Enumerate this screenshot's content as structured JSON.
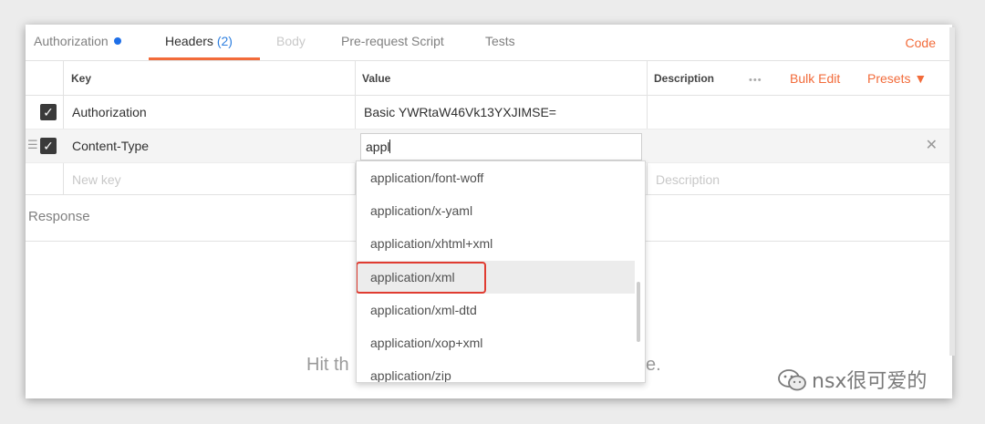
{
  "tabs": [
    {
      "label": "Authorization"
    },
    {
      "label": "Headers",
      "count": "(2)"
    },
    {
      "label": "Body"
    },
    {
      "label": "Pre-request Script"
    },
    {
      "label": "Tests"
    }
  ],
  "code_link": "Code",
  "table": {
    "headers": {
      "key": "Key",
      "value": "Value",
      "description": "Description"
    },
    "bulk_edit": "Bulk Edit",
    "presets": "Presets ▼",
    "more": "•••",
    "rows": [
      {
        "checked": true,
        "key": "Authorization",
        "value": "Basic YWRtaW46Vk13YXJIMSE="
      },
      {
        "checked": true,
        "key": "Content-Type",
        "value": "appl"
      }
    ],
    "new_row": {
      "key_placeholder": "New key",
      "description_placeholder": "Description"
    }
  },
  "response_label": "Response",
  "hint": {
    "left": "Hit th",
    "right": "e."
  },
  "autocomplete": {
    "items": [
      "application/font-woff",
      "application/x-yaml",
      "application/xhtml+xml",
      "application/xml",
      "application/xml-dtd",
      "application/xop+xml",
      "application/zip"
    ],
    "highlighted": "application/xml"
  },
  "watermark": "nsx很可爱的",
  "colors": {
    "accent": "#f26b3a",
    "count_blue": "#2d7fe0",
    "highlight_border": "#e03c31"
  }
}
